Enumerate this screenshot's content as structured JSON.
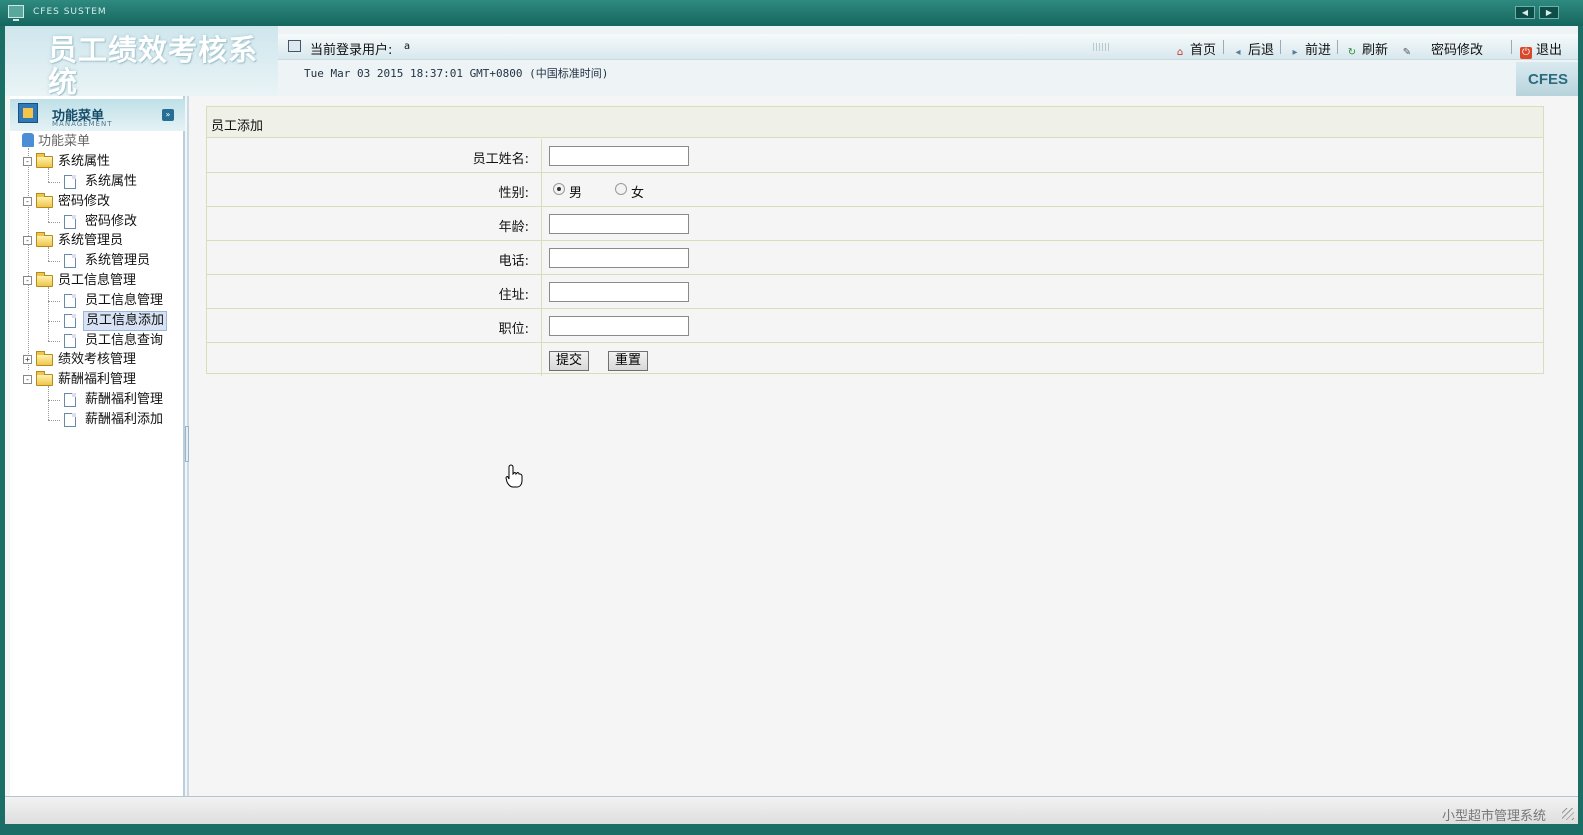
{
  "window": {
    "title": "CFES SUSTEM",
    "nav_prev": "◀",
    "nav_next": "▶"
  },
  "header": {
    "logo_text": "员工绩效考核系统",
    "user_label": "当前登录用户:",
    "user_value": "a",
    "datetime": "Tue Mar 03 2015 18:37:01 GMT+0800 (中国标准时间)",
    "badge": "CFES",
    "toolbar": {
      "home": "首页",
      "back": "后退",
      "forward": "前进",
      "refresh": "刷新",
      "password": "密码修改",
      "logout": "退出"
    },
    "icons": {
      "home": "home-icon",
      "back": "back-arrow-icon",
      "forward": "forward-arrow-icon",
      "refresh": "refresh-icon",
      "password": "edit-password-icon",
      "logout": "logout-icon"
    }
  },
  "menu": {
    "title": "功能菜单",
    "subtitle": "MANAGEMENT",
    "toggle": "»",
    "root": "功能菜单",
    "groups": [
      {
        "label": "系统属性",
        "expander": "-",
        "items": [
          "系统属性"
        ]
      },
      {
        "label": "密码修改",
        "expander": "-",
        "items": [
          "密码修改"
        ]
      },
      {
        "label": "系统管理员",
        "expander": "-",
        "items": [
          "系统管理员"
        ]
      },
      {
        "label": "员工信息管理",
        "expander": "-",
        "items": [
          "员工信息管理",
          "员工信息添加",
          "员工信息查询"
        ]
      },
      {
        "label": "绩效考核管理",
        "expander": "+",
        "items": []
      },
      {
        "label": "薪酬福利管理",
        "expander": "-",
        "items": [
          "薪酬福利管理",
          "薪酬福利添加"
        ]
      }
    ],
    "selected_item": "员工信息添加"
  },
  "form": {
    "title": "员工添加",
    "fields": {
      "name_label": "员工姓名:",
      "name_value": "",
      "gender_label": "性别:",
      "gender_male": "男",
      "gender_female": "女",
      "gender_selected": "男",
      "age_label": "年龄:",
      "age_value": "",
      "phone_label": "电话:",
      "phone_value": "",
      "address_label": "住址:",
      "address_value": "",
      "position_label": "职位:",
      "position_value": ""
    },
    "submit": "提交",
    "reset": "重置"
  },
  "status": {
    "text": "小型超市管理系统"
  },
  "colors": {
    "frame": "#1b6e66",
    "form_border": "#d6dfb9",
    "form_title_bg": "#eff0e7",
    "menu_text_root": "#666666"
  }
}
